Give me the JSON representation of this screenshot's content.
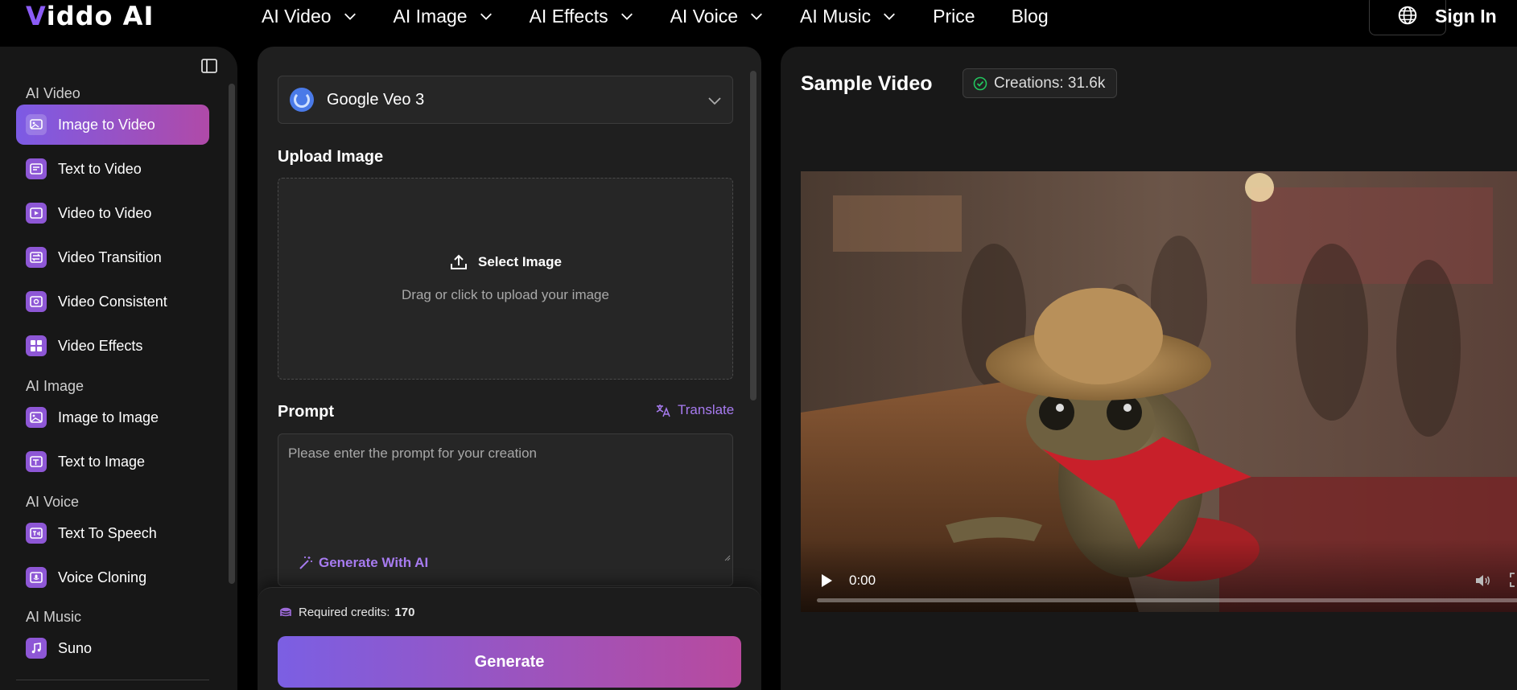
{
  "brand": {
    "logo_v": "V",
    "logo_rest": "iddo AI"
  },
  "nav": [
    {
      "label": "AI Video",
      "has_dropdown": true
    },
    {
      "label": "AI Image",
      "has_dropdown": true
    },
    {
      "label": "AI Effects",
      "has_dropdown": true
    },
    {
      "label": "AI Voice",
      "has_dropdown": true
    },
    {
      "label": "AI Music",
      "has_dropdown": true
    },
    {
      "label": "Price",
      "has_dropdown": false
    },
    {
      "label": "Blog",
      "has_dropdown": false
    }
  ],
  "header": {
    "language_icon": "globe-icon",
    "sign_in": "Sign In"
  },
  "sidebar": {
    "collapse_icon": "sidebar-toggle-icon",
    "groups": [
      {
        "title": "AI Video",
        "items": [
          {
            "label": "Image to Video",
            "icon": "image-to-video-icon",
            "active": true
          },
          {
            "label": "Text to Video",
            "icon": "text-to-video-icon",
            "active": false
          },
          {
            "label": "Video to Video",
            "icon": "video-to-video-icon",
            "active": false
          },
          {
            "label": "Video Transition",
            "icon": "video-transition-icon",
            "active": false
          },
          {
            "label": "Video Consistent",
            "icon": "video-consistent-icon",
            "active": false
          },
          {
            "label": "Video Effects",
            "icon": "video-effects-icon",
            "active": false
          }
        ]
      },
      {
        "title": "AI Image",
        "items": [
          {
            "label": "Image to Image",
            "icon": "image-to-image-icon",
            "active": false
          },
          {
            "label": "Text to Image",
            "icon": "text-to-image-icon",
            "active": false
          }
        ]
      },
      {
        "title": "AI Voice",
        "items": [
          {
            "label": "Text To Speech",
            "icon": "text-to-speech-icon",
            "active": false
          },
          {
            "label": "Voice Cloning",
            "icon": "voice-cloning-icon",
            "active": false
          }
        ]
      },
      {
        "title": "AI Music",
        "items": [
          {
            "label": "Suno",
            "icon": "music-note-icon",
            "active": false
          }
        ]
      }
    ]
  },
  "form": {
    "model": {
      "name": "Google Veo 3",
      "icon": "google-veo-logo"
    },
    "upload": {
      "label": "Upload Image",
      "button": "Select Image",
      "hint": "Drag or click to upload your image"
    },
    "prompt": {
      "label": "Prompt",
      "translate": "Translate",
      "value": "",
      "placeholder": "Please enter the prompt for your creation",
      "generate_ai": "Generate With AI"
    },
    "credits": {
      "label": "Required credits:",
      "value": "170"
    },
    "generate": "Generate"
  },
  "sample": {
    "title": "Sample Video",
    "creations": "Creations: 31.6k",
    "video": {
      "time": "0:00",
      "progress": 0
    }
  },
  "colors": {
    "accent_purple": "#8b5cf6",
    "gradient_start": "#7b5fe3",
    "gradient_end": "#b84a9e",
    "link_purple": "#a77bf0",
    "success_green": "#22c55e"
  }
}
